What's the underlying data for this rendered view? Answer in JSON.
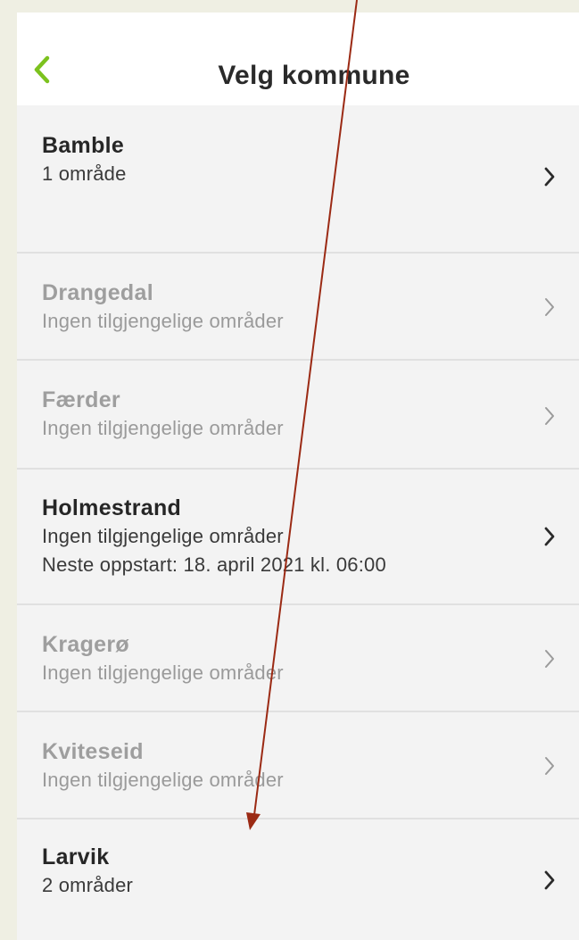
{
  "header": {
    "title": "Velg kommune",
    "back_icon": "chevron-left-icon"
  },
  "colors": {
    "accent": "#7cc21e",
    "annotation_arrow": "#9b2a14"
  },
  "municipalities": [
    {
      "name": "Bamble",
      "lines": [
        "1 område"
      ],
      "available": true
    },
    {
      "name": "Drangedal",
      "lines": [
        "Ingen tilgjengelige områder"
      ],
      "available": false
    },
    {
      "name": "Færder",
      "lines": [
        "Ingen tilgjengelige områder"
      ],
      "available": false
    },
    {
      "name": "Holmestrand",
      "lines": [
        "Ingen tilgjengelige områder",
        "Neste oppstart: 18. april 2021 kl. 06:00"
      ],
      "available": true
    },
    {
      "name": "Kragerø",
      "lines": [
        "Ingen tilgjengelige områder"
      ],
      "available": false
    },
    {
      "name": "Kviteseid",
      "lines": [
        "Ingen tilgjengelige områder"
      ],
      "available": false
    },
    {
      "name": "Larvik",
      "lines": [
        "2 områder"
      ],
      "available": true
    }
  ]
}
